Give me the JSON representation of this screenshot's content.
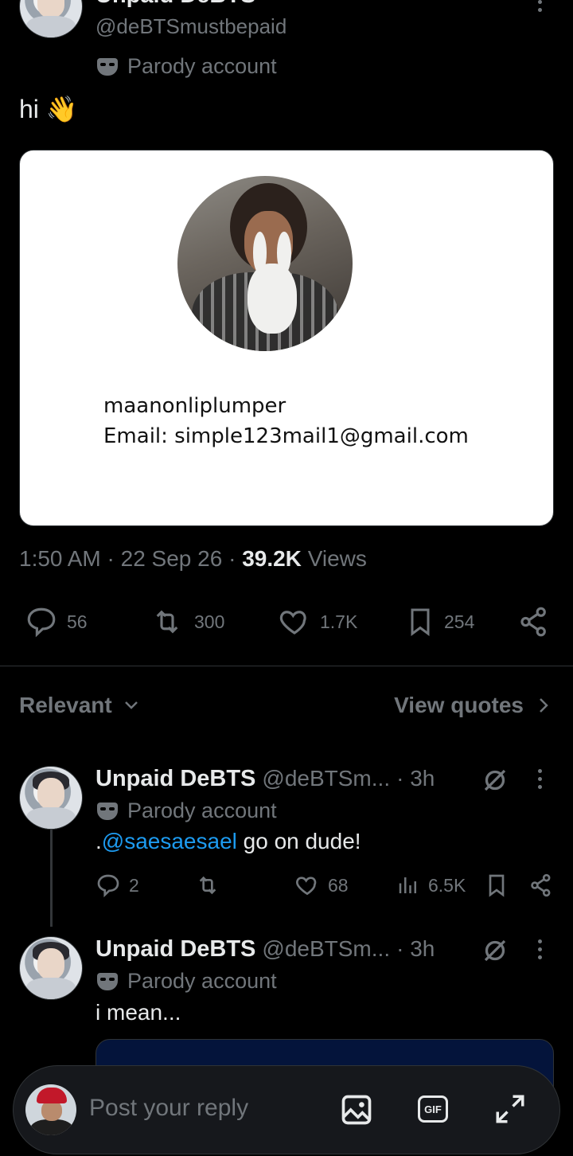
{
  "tweet": {
    "author_name": "Unpaid DeBTS",
    "author_handle": "@deBTSmustbepaid",
    "parody_label": "Parody account",
    "text": "hi 👋",
    "card": {
      "username": "maanonliplumper",
      "email_line": "Email: simple123mail1@gmail.com"
    },
    "time": "1:50 AM",
    "date": "22 Sep 26",
    "views_count": "39.2K",
    "views_label": "Views",
    "actions": {
      "replies": "56",
      "reposts": "300",
      "likes": "1.7K",
      "bookmarks": "254"
    }
  },
  "replies_header": {
    "sort_label": "Relevant",
    "quotes_label": "View quotes"
  },
  "replies": [
    {
      "name": "Unpaid DeBTS",
      "handle": "@deBTSm...",
      "time": "· 3h",
      "parody_label": "Parody account",
      "text_prefix": ".",
      "mention": "@saesaesael",
      "text_suffix": " go on dude!",
      "replies": "2",
      "likes": "68",
      "views": "6.5K"
    },
    {
      "name": "Unpaid DeBTS",
      "handle": "@deBTSm...",
      "time": "· 3h",
      "parody_label": "Parody account",
      "text": "i mean..."
    }
  ],
  "composer": {
    "placeholder": "Post your reply",
    "gif_label": "GIF"
  },
  "colors": {
    "background": "#000000",
    "text": "#e7e9ea",
    "secondary": "#71767b",
    "link": "#1d9bf0",
    "composer_bg": "#16181c"
  }
}
